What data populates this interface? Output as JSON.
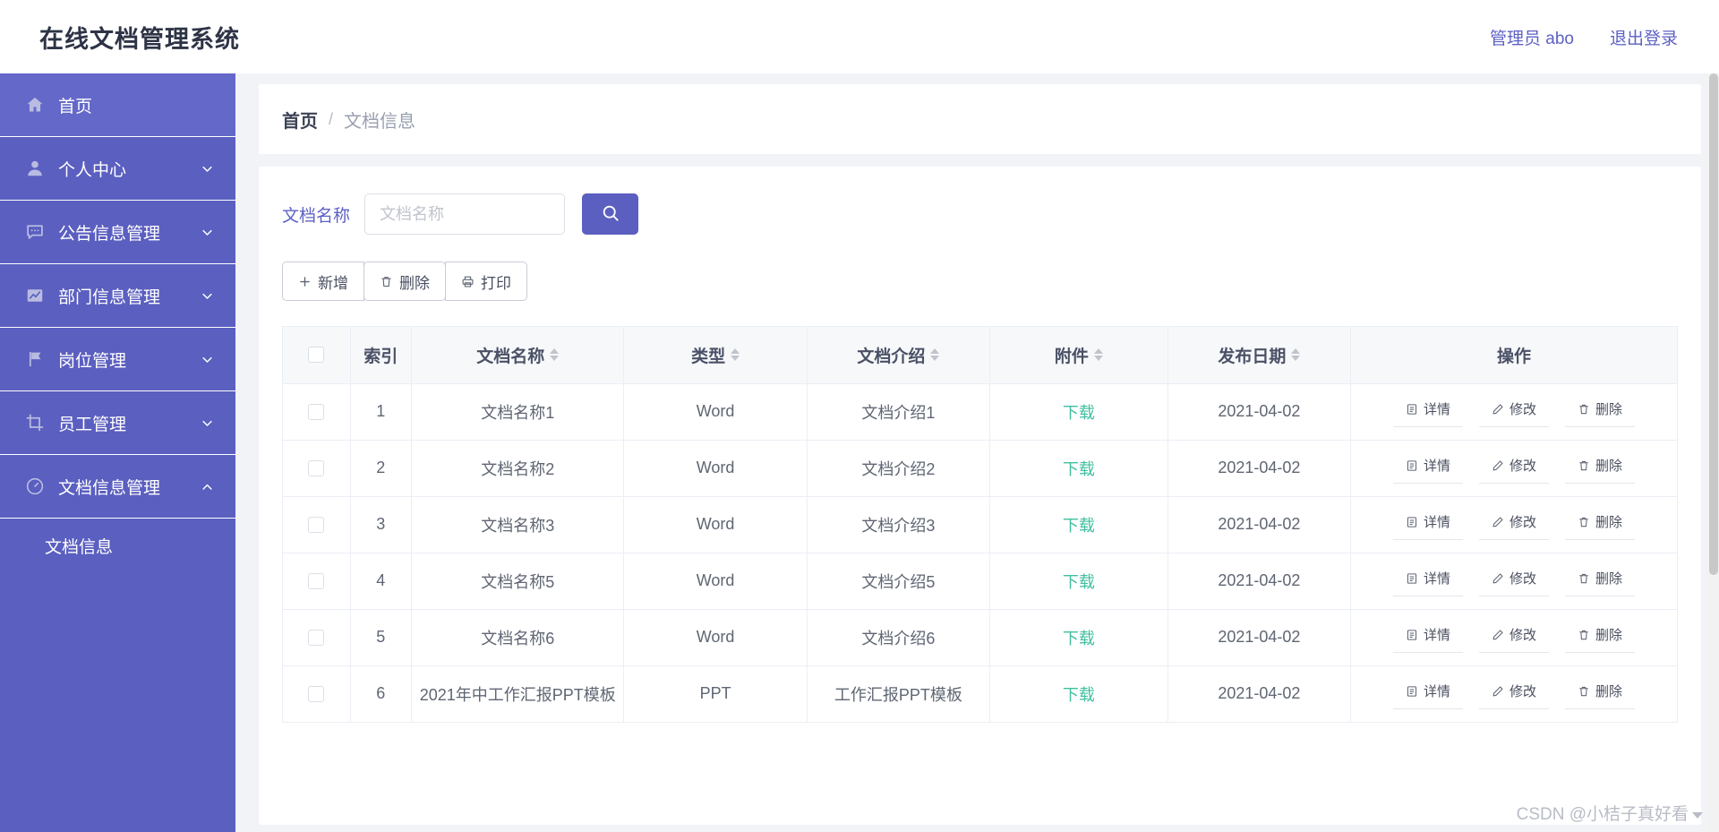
{
  "header": {
    "title": "在线文档管理系统",
    "user_label": "管理员 abo",
    "logout_label": "退出登录"
  },
  "sidebar": {
    "items": [
      {
        "label": "首页",
        "icon": "home-icon",
        "expandable": false,
        "active": true
      },
      {
        "label": "个人中心",
        "icon": "user-icon",
        "expandable": true,
        "expanded": false
      },
      {
        "label": "公告信息管理",
        "icon": "message-icon",
        "expandable": true,
        "expanded": false
      },
      {
        "label": "部门信息管理",
        "icon": "chart-icon",
        "expandable": true,
        "expanded": false
      },
      {
        "label": "岗位管理",
        "icon": "flag-icon",
        "expandable": true,
        "expanded": false
      },
      {
        "label": "员工管理",
        "icon": "crop-icon",
        "expandable": true,
        "expanded": false
      },
      {
        "label": "文档信息管理",
        "icon": "odometer-icon",
        "expandable": true,
        "expanded": true
      }
    ],
    "submenu": [
      {
        "label": "文档信息"
      }
    ]
  },
  "breadcrumb": {
    "home": "首页",
    "separator": "/",
    "current": "文档信息"
  },
  "search": {
    "label": "文档名称",
    "placeholder": "文档名称",
    "value": "",
    "button_icon": "search-icon"
  },
  "actions": [
    {
      "label": "新增",
      "icon": "plus-icon"
    },
    {
      "label": "删除",
      "icon": "trash-icon"
    },
    {
      "label": "打印",
      "icon": "print-icon"
    }
  ],
  "table": {
    "columns": [
      {
        "key": "select",
        "label": "",
        "sortable": false
      },
      {
        "key": "index",
        "label": "索引",
        "sortable": false
      },
      {
        "key": "name",
        "label": "文档名称",
        "sortable": true
      },
      {
        "key": "type",
        "label": "类型",
        "sortable": true
      },
      {
        "key": "intro",
        "label": "文档介绍",
        "sortable": true
      },
      {
        "key": "attachment",
        "label": "附件",
        "sortable": true
      },
      {
        "key": "date",
        "label": "发布日期",
        "sortable": true
      },
      {
        "key": "ops",
        "label": "操作",
        "sortable": false
      }
    ],
    "download_label": "下载",
    "row_ops": [
      {
        "label": "详情",
        "icon": "detail-icon"
      },
      {
        "label": "修改",
        "icon": "edit-icon"
      },
      {
        "label": "删除",
        "icon": "trash-icon"
      }
    ],
    "rows": [
      {
        "index": "1",
        "name": "文档名称1",
        "type": "Word",
        "intro": "文档介绍1",
        "attachment": "下载",
        "date": "2021-04-02"
      },
      {
        "index": "2",
        "name": "文档名称2",
        "type": "Word",
        "intro": "文档介绍2",
        "attachment": "下载",
        "date": "2021-04-02"
      },
      {
        "index": "3",
        "name": "文档名称3",
        "type": "Word",
        "intro": "文档介绍3",
        "attachment": "下载",
        "date": "2021-04-02"
      },
      {
        "index": "4",
        "name": "文档名称5",
        "type": "Word",
        "intro": "文档介绍5",
        "attachment": "下载",
        "date": "2021-04-02"
      },
      {
        "index": "5",
        "name": "文档名称6",
        "type": "Word",
        "intro": "文档介绍6",
        "attachment": "下载",
        "date": "2021-04-02"
      },
      {
        "index": "6",
        "name": "2021年中工作汇报PPT模板",
        "type": "PPT",
        "intro": "工作汇报PPT模板",
        "attachment": "下载",
        "date": "2021-04-02"
      }
    ]
  },
  "watermark": {
    "text": "CSDN @小桔子真好看"
  },
  "colors": {
    "sidebar_bg": "#5b5fc0",
    "sidebar_active": "#6468c9",
    "accent": "#5b5fc0",
    "link": "#5d61c4",
    "download": "#3fbf9f",
    "page_bg": "#f2f3f7",
    "header_text": "#2e3446"
  }
}
